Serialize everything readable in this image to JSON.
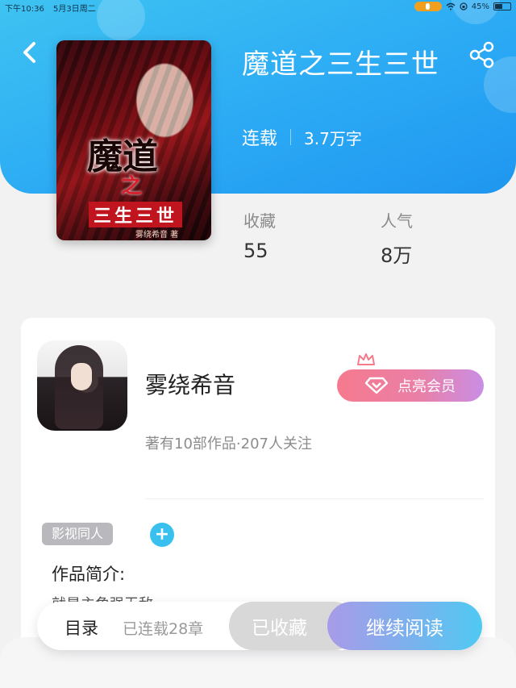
{
  "status_bar": {
    "time": "下午10:36",
    "date": "5月3日周二",
    "battery": "45%"
  },
  "book": {
    "title": "魔道之三生三世",
    "serial_status": "连载",
    "word_count": "3.7万字",
    "cover": {
      "title_main": "魔道",
      "title_zhi": "之",
      "title_sub": "三生三世",
      "author_credit": "雾绕希音 著"
    }
  },
  "stats": {
    "favorites_label": "收藏",
    "favorites_value": "55",
    "popularity_label": "人气",
    "popularity_value": "8万"
  },
  "author": {
    "name": "雾绕希音",
    "meta": "著有10部作品·207人关注",
    "member_button": "点亮会员"
  },
  "tags": [
    "影视同人"
  ],
  "add_tag": "+",
  "intro": {
    "label": "作品简介:",
    "text": "就是主角强无敌..."
  },
  "bottom_bar": {
    "toc": "目录",
    "chapters": "已连载28章",
    "collected": "已收藏",
    "continue_reading": "继续阅读"
  },
  "icons": {
    "back": "chevron-left-icon",
    "share": "share-icon",
    "gem": "diamond-icon",
    "crown": "crown-icon"
  },
  "colors": {
    "header_blue": "#2aa8f4",
    "member_pink": "#f67a8e",
    "read_gradient_end": "#4fc9f2",
    "tag_gray": "#b9b9bd",
    "add_blue": "#39c0ef"
  }
}
